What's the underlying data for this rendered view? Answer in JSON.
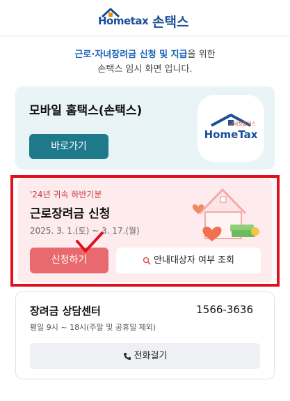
{
  "header": {
    "logo_text": "Hometax",
    "brand": "손택스"
  },
  "notice": {
    "highlight": "근로·자녀장려금 신청 및 지급",
    "line1_suffix": "을 위한",
    "line2": "손택스 임시 화면 입니다."
  },
  "mobile_card": {
    "title": "모바일 홈택스(손택스)",
    "button_label": "바로가기",
    "app_icon": {
      "small_text": "국세청홈택스",
      "big_text": "HomeTax"
    }
  },
  "apply_card": {
    "tag": "'24년 귀속 하반기분",
    "title": "근로장려금 신청",
    "period": "2025. 3. 1.(토) ~ 3. 17.(월)",
    "apply_button": "신청하기",
    "lookup_button": "안내대상자 여부 조회"
  },
  "center_card": {
    "name": "장려금 상담센터",
    "phone": "1566-3636",
    "hours": "평일 9시 ~ 18시(주말 및 공휴일 제외)",
    "call_button": "전화걸기"
  },
  "colors": {
    "brand_blue": "#1a4f99",
    "teal": "#1e7a8a",
    "apply_red": "#e86a6e",
    "frame_red": "#e0101d"
  }
}
